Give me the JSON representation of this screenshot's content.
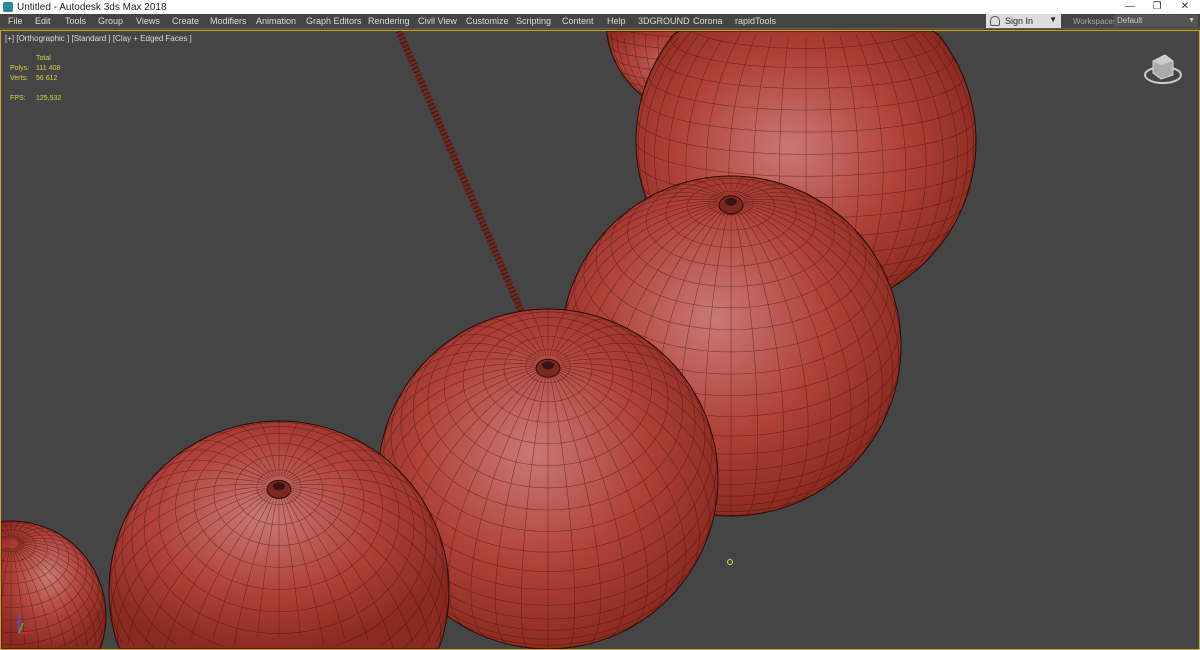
{
  "window": {
    "title": "Untitled - Autodesk 3ds Max 2018",
    "minimize": "—",
    "restore": "❐",
    "close": "✕"
  },
  "menu": [
    "File",
    "Edit",
    "Tools",
    "Group",
    "Views",
    "Create",
    "Modifiers",
    "Animation",
    "Graph Editors",
    "Rendering",
    "Civil View",
    "Customize",
    "Scripting",
    "Content",
    "Help",
    "3DGROUND",
    "Corona",
    "rapidTools"
  ],
  "account": {
    "sign_in": "Sign In",
    "dropdown": "▼"
  },
  "workspaces": {
    "label": "Workspaces:",
    "value": "Default",
    "dropdown": "▼"
  },
  "viewport": {
    "label": "[+] [Orthographic ] [Standard ] [Clay + Edged Faces ]",
    "stats": {
      "header": "Total",
      "polys_label": "Polys:",
      "polys": "111 408",
      "verts_label": "Verts:",
      "verts": "56 612",
      "fps_label": "FPS:",
      "fps": "125,532"
    }
  },
  "colors": {
    "sphere": "#b03a2e",
    "background": "#454545",
    "active_border": "#c8a830",
    "stats_text": "#d9d250"
  }
}
